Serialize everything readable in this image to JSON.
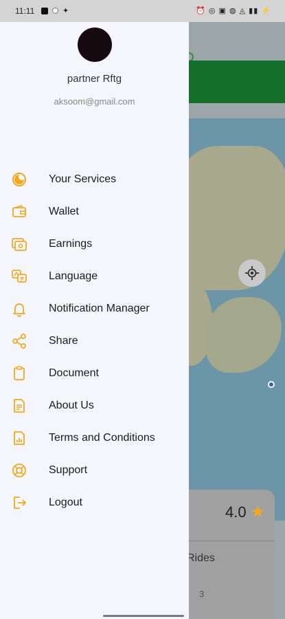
{
  "status_bar": {
    "time": "11:11",
    "right_icons_text": "⏰ ◎ ▣ ◍ ◬ ▮▮ ⚡",
    "left_icons": [
      "notification-square-icon",
      "circle-icon",
      "twitter-bird-icon"
    ]
  },
  "drawer": {
    "user": {
      "name": "partner Rftg",
      "email": "aksoom@gmail.com"
    },
    "menu": [
      {
        "label": "Your Services",
        "icon": "services-icon"
      },
      {
        "label": "Wallet",
        "icon": "wallet-icon"
      },
      {
        "label": "Earnings",
        "icon": "earnings-icon"
      },
      {
        "label": "Language",
        "icon": "language-icon"
      },
      {
        "label": "Notification Manager",
        "icon": "bell-icon"
      },
      {
        "label": "Share",
        "icon": "share-icon"
      },
      {
        "label": "Document",
        "icon": "document-icon"
      },
      {
        "label": "About Us",
        "icon": "about-icon"
      },
      {
        "label": "Terms and Conditions",
        "icon": "terms-icon"
      },
      {
        "label": "Support",
        "icon": "support-icon"
      },
      {
        "label": "Logout",
        "icon": "logout-icon"
      }
    ]
  },
  "background": {
    "rating": "4.0",
    "rides_label": "Rides",
    "rides_value": "3"
  },
  "colors": {
    "accent": "#f2a81d",
    "drawer_bg": "#f5f6fb",
    "header_green": "#136f2a"
  }
}
